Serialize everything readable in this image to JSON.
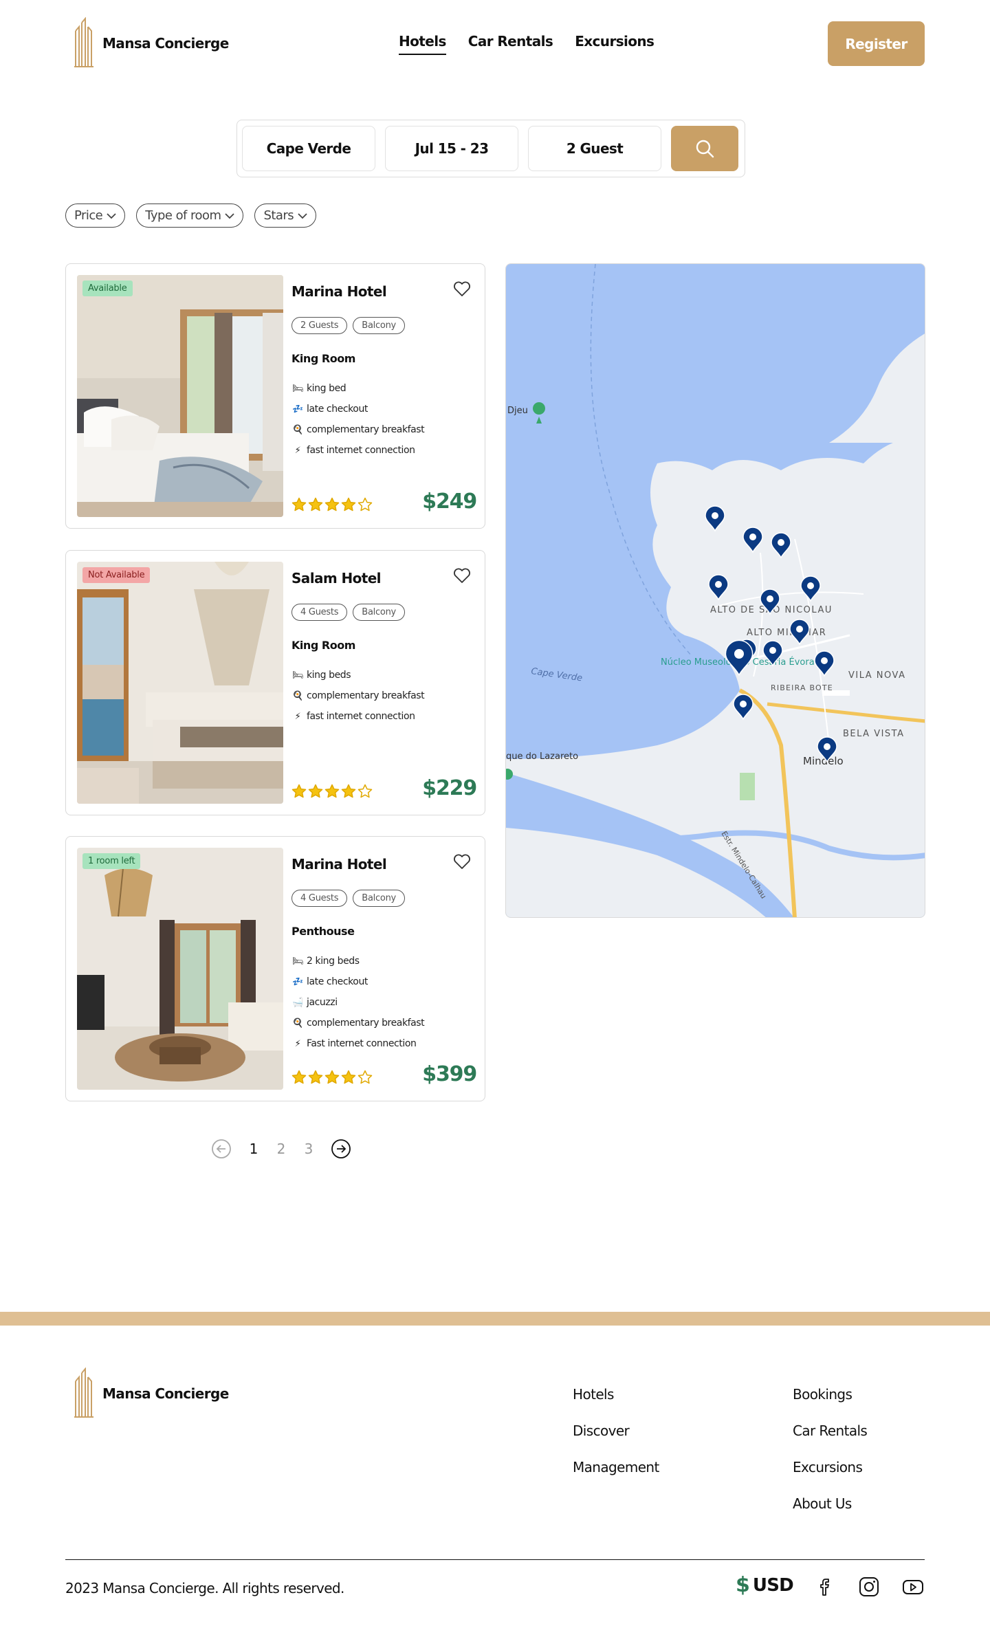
{
  "brand": {
    "name": "Mansa Concierge",
    "accent": "#c9a066",
    "price_color": "#2d7a56"
  },
  "nav": {
    "items": [
      {
        "label": "Hotels",
        "active": true
      },
      {
        "label": "Car Rentals",
        "active": false
      },
      {
        "label": "Excursions",
        "active": false
      }
    ],
    "register_label": "Register"
  },
  "search": {
    "location": "Cape Verde",
    "dates": "Jul 15 - 23",
    "guests": "2 Guest",
    "button_icon": "search-icon"
  },
  "filters": [
    {
      "label": "Price"
    },
    {
      "label": "Type of room"
    },
    {
      "label": "Stars"
    }
  ],
  "listings": [
    {
      "status": "Available",
      "status_color": "green",
      "name": "Marina Hotel",
      "tags": [
        "2 Guests",
        "Balcony"
      ],
      "room_type": "King Room",
      "amenities": [
        {
          "icon": "bed-icon",
          "glyph": "🛏",
          "text": "king bed"
        },
        {
          "icon": "sleep-icon",
          "glyph": "💤",
          "text": "late checkout"
        },
        {
          "icon": "breakfast-icon",
          "glyph": "🍳",
          "text": "complementary breakfast"
        },
        {
          "icon": "lightning-icon",
          "glyph": "⚡",
          "text": "fast internet connection"
        }
      ],
      "rating": 4,
      "rating_max": 5,
      "price": "$249"
    },
    {
      "status": "Not Available",
      "status_color": "red",
      "name": "Salam Hotel",
      "tags": [
        "4 Guests",
        "Balcony"
      ],
      "room_type": "King Room",
      "amenities": [
        {
          "icon": "bed-icon",
          "glyph": "🛏",
          "text": "king beds"
        },
        {
          "icon": "breakfast-icon",
          "glyph": "🍳",
          "text": "complementary breakfast"
        },
        {
          "icon": "lightning-icon",
          "glyph": "⚡",
          "text": "fast internet connection"
        }
      ],
      "rating": 4,
      "rating_max": 5,
      "price": "$229"
    },
    {
      "status": "1 room left",
      "status_color": "green",
      "name": "Marina Hotel",
      "tags": [
        "4 Guests",
        "Balcony"
      ],
      "room_type": "Penthouse",
      "amenities": [
        {
          "icon": "bed-icon",
          "glyph": "🛏",
          "text": "2 king beds"
        },
        {
          "icon": "sleep-icon",
          "glyph": "💤",
          "text": "late checkout"
        },
        {
          "icon": "bathtub-icon",
          "glyph": "🛁",
          "text": "jacuzzi"
        },
        {
          "icon": "breakfast-icon",
          "glyph": "🍳",
          "text": "complementary breakfast"
        },
        {
          "icon": "lightning-icon",
          "glyph": "⚡",
          "text": "Fast internet connection"
        }
      ],
      "rating": 4,
      "rating_max": 5,
      "price": "$399"
    }
  ],
  "map": {
    "labels": {
      "alto_nicolau": "ALTO DE SÃO NICOLAU",
      "alto_miramar": "ALTO MIRAMAR",
      "museum": "Núcleo Museológico Cesária Évora",
      "cape_verde": "Cape Verde",
      "ribeira_bote": "RIBEIRA BOTE",
      "vila_nova": "VILA NOVA",
      "bela_vista": "BELA VISTA",
      "mindelo": "Mindelo",
      "lazareto": "que do Lazareto",
      "djeu": "Djeu",
      "road": "Estr. Mindelo-Calhau"
    },
    "pin_count": 13
  },
  "pagination": {
    "pages": [
      "1",
      "2",
      "3"
    ],
    "current": "1"
  },
  "footer": {
    "brand": "Mansa Concierge",
    "col1": [
      "Hotels",
      "Discover",
      "Management"
    ],
    "col2": [
      "Bookings",
      "Car Rentals",
      "Excursions",
      "About Us"
    ],
    "copyright": "2023 Mansa Concierge. All rights reserved.",
    "currency_symbol": "$",
    "currency": "USD",
    "social": [
      "facebook-icon",
      "instagram-icon",
      "youtube-icon"
    ]
  }
}
